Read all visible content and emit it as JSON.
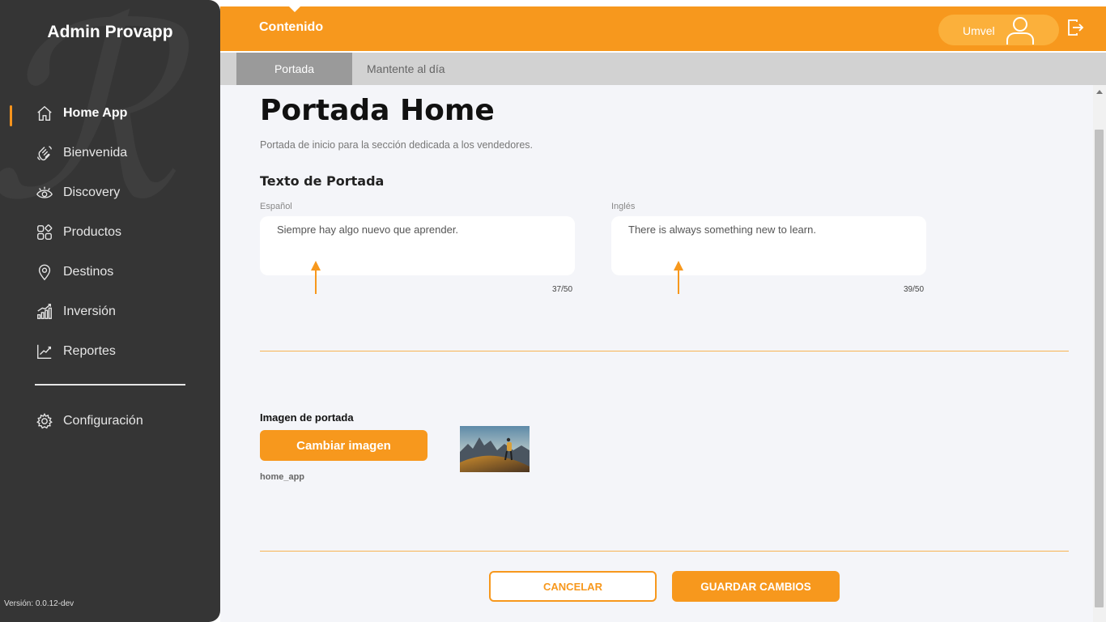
{
  "sidebar": {
    "title": "Admin Provapp",
    "items": [
      {
        "label": "Home App",
        "icon": "home-icon"
      },
      {
        "label": "Bienvenida",
        "icon": "wave-hand-icon"
      },
      {
        "label": "Discovery",
        "icon": "eye-icon"
      },
      {
        "label": "Productos",
        "icon": "grid-icon"
      },
      {
        "label": "Destinos",
        "icon": "map-pin-icon"
      },
      {
        "label": "Inversión",
        "icon": "bar-chart-icon"
      },
      {
        "label": "Reportes",
        "icon": "line-chart-icon"
      }
    ],
    "config_label": "Configuración",
    "version": "Versión: 0.0.12-dev"
  },
  "topbar": {
    "title": "Contenido",
    "user_name": "Umvel",
    "accent_color": "#f7981d"
  },
  "tabs": [
    {
      "label": "Portada",
      "active": true
    },
    {
      "label": "Mantente al día",
      "active": false
    }
  ],
  "main": {
    "title": "Portada Home",
    "description": "Portada de inicio para la sección dedicada a los vendedores.",
    "text_section_title": "Texto de Portada",
    "spanish": {
      "label": "Español",
      "value": "Siempre hay algo nuevo que aprender.",
      "counter": "37/50"
    },
    "english": {
      "label": "Inglés",
      "value": "There is always something new to learn.",
      "counter": "39/50"
    },
    "image_label": "Imagen de portada",
    "change_image_label": "Cambiar imagen",
    "file_name": "home_app"
  },
  "actions": {
    "cancel_label": "CANCELAR",
    "save_label": "GUARDAR CAMBIOS"
  }
}
